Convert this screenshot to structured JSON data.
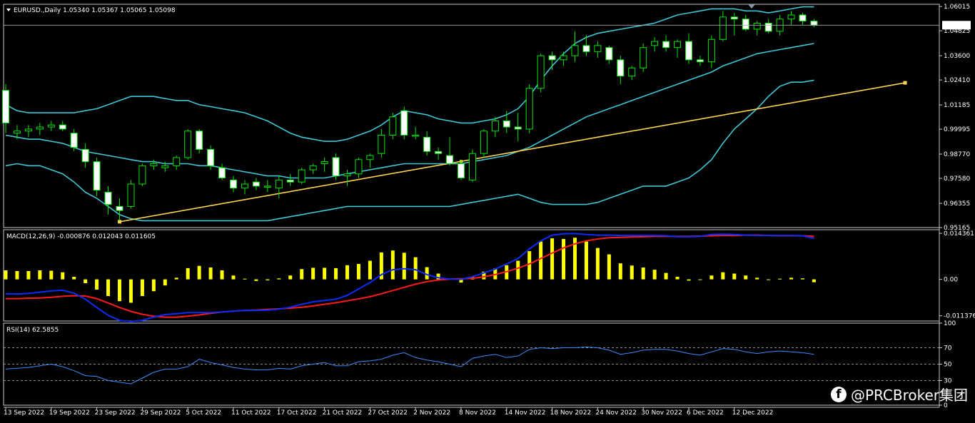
{
  "chart_data": {
    "type": "candlestick",
    "header": "EURUSD.,Daily  1.05340 1.05367 1.05065 1.05098",
    "current_price_label": "1.05098",
    "current_price": 1.05098,
    "price_ylim": [
      0.95165,
      1.06125
    ],
    "price_ticks": [
      "1.06015",
      "1.04825",
      "1.03600",
      "1.02410",
      "1.01185",
      "0.99995",
      "0.98770",
      "0.97580",
      "0.96355",
      "0.95165"
    ],
    "dates": [
      "13 Sep 2022",
      "19 Sep 2022",
      "23 Sep 2022",
      "29 Sep 2022",
      "5 Oct 2022",
      "11 Oct 2022",
      "17 Oct 2022",
      "21 Oct 2022",
      "27 Oct 2022",
      "2 Nov 2022",
      "8 Nov 2022",
      "14 Nov 2022",
      "18 Nov 2022",
      "24 Nov 2022",
      "30 Nov 2022",
      "6 Dec 2022",
      "12 Dec 2022"
    ],
    "candles": [
      [
        1.019,
        1.022,
        0.998,
        1.003
      ],
      [
        0.998,
        1.002,
        0.995,
        0.999
      ],
      [
        0.999,
        1.002,
        0.996,
        1.0
      ],
      [
        1.0,
        1.003,
        0.997,
        1.001
      ],
      [
        1.001,
        1.004,
        0.999,
        1.002
      ],
      [
        1.002,
        1.004,
        0.999,
        1.0
      ],
      [
        0.998,
        1.0,
        0.989,
        0.991
      ],
      [
        0.99,
        0.993,
        0.981,
        0.984
      ],
      [
        0.984,
        0.986,
        0.967,
        0.97
      ],
      [
        0.969,
        0.972,
        0.958,
        0.963
      ],
      [
        0.962,
        0.966,
        0.955,
        0.96
      ],
      [
        0.962,
        0.975,
        0.961,
        0.973
      ],
      [
        0.973,
        0.983,
        0.972,
        0.982
      ],
      [
        0.982,
        0.985,
        0.98,
        0.983
      ],
      [
        0.981,
        0.984,
        0.979,
        0.982
      ],
      [
        0.982,
        0.987,
        0.98,
        0.986
      ],
      [
        0.986,
        1.0,
        0.985,
        0.999
      ],
      [
        0.999,
        1.0,
        0.988,
        0.99
      ],
      [
        0.99,
        0.992,
        0.98,
        0.982
      ],
      [
        0.981,
        0.983,
        0.975,
        0.976
      ],
      [
        0.975,
        0.977,
        0.969,
        0.971
      ],
      [
        0.971,
        0.975,
        0.968,
        0.973
      ],
      [
        0.974,
        0.976,
        0.97,
        0.972
      ],
      [
        0.972,
        0.975,
        0.969,
        0.972
      ],
      [
        0.971,
        0.977,
        0.966,
        0.975
      ],
      [
        0.975,
        0.978,
        0.972,
        0.974
      ],
      [
        0.974,
        0.981,
        0.973,
        0.98
      ],
      [
        0.98,
        0.983,
        0.978,
        0.982
      ],
      [
        0.983,
        0.986,
        0.979,
        0.984
      ],
      [
        0.986,
        0.988,
        0.975,
        0.977
      ],
      [
        0.977,
        0.98,
        0.972,
        0.978
      ],
      [
        0.978,
        0.986,
        0.976,
        0.985
      ],
      [
        0.985,
        0.988,
        0.981,
        0.987
      ],
      [
        0.988,
        1.0,
        0.986,
        0.997
      ],
      [
        0.997,
        1.008,
        0.995,
        1.006
      ],
      [
        1.009,
        1.011,
        0.995,
        0.997
      ],
      [
        0.997,
        1.001,
        0.995,
        0.997
      ],
      [
        0.996,
        0.999,
        0.987,
        0.989
      ],
      [
        0.989,
        0.991,
        0.985,
        0.988
      ],
      [
        0.987,
        0.996,
        0.982,
        0.983
      ],
      [
        0.983,
        0.985,
        0.975,
        0.976
      ],
      [
        0.975,
        0.99,
        0.974,
        0.988
      ],
      [
        0.988,
        1.0,
        0.986,
        0.999
      ],
      [
        0.999,
        1.006,
        0.996,
        1.004
      ],
      [
        1.004,
        1.009,
        0.998,
        1.001
      ],
      [
        1.001,
        1.008,
        0.994,
        1.0
      ],
      [
        1.0,
        1.022,
        0.998,
        1.02
      ],
      [
        1.02,
        1.037,
        1.018,
        1.036
      ],
      [
        1.036,
        1.038,
        1.029,
        1.034
      ],
      [
        1.034,
        1.038,
        1.031,
        1.036
      ],
      [
        1.036,
        1.048,
        1.033,
        1.041
      ],
      [
        1.041,
        1.046,
        1.036,
        1.038
      ],
      [
        1.038,
        1.043,
        1.035,
        1.041
      ],
      [
        1.04,
        1.041,
        1.032,
        1.034
      ],
      [
        1.034,
        1.036,
        1.022,
        1.026
      ],
      [
        1.026,
        1.031,
        1.024,
        1.03
      ],
      [
        1.03,
        1.042,
        1.028,
        1.04
      ],
      [
        1.041,
        1.045,
        1.038,
        1.043
      ],
      [
        1.043,
        1.046,
        1.038,
        1.04
      ],
      [
        1.04,
        1.044,
        1.035,
        1.043
      ],
      [
        1.043,
        1.047,
        1.032,
        1.034
      ],
      [
        1.034,
        1.036,
        1.031,
        1.033
      ],
      [
        1.033,
        1.046,
        1.03,
        1.044
      ],
      [
        1.044,
        1.058,
        1.043,
        1.055
      ],
      [
        1.055,
        1.057,
        1.046,
        1.054
      ],
      [
        1.054,
        1.056,
        1.048,
        1.049
      ],
      [
        1.049,
        1.053,
        1.046,
        1.052
      ],
      [
        1.052,
        1.054,
        1.047,
        1.048
      ],
      [
        1.048,
        1.056,
        1.046,
        1.054
      ],
      [
        1.054,
        1.058,
        1.051,
        1.056
      ],
      [
        1.056,
        1.057,
        1.051,
        1.053
      ],
      [
        1.053,
        1.054,
        1.05,
        1.051
      ]
    ],
    "bollinger": {
      "upper": [
        1.012,
        1.009,
        1.008,
        1.008,
        1.008,
        1.008,
        1.008,
        1.009,
        1.01,
        1.012,
        1.014,
        1.016,
        1.016,
        1.016,
        1.015,
        1.014,
        1.014,
        1.012,
        1.011,
        1.01,
        1.009,
        1.008,
        1.006,
        1.004,
        1.001,
        0.998,
        0.996,
        0.995,
        0.994,
        0.994,
        0.995,
        0.997,
        0.999,
        1.002,
        1.006,
        1.009,
        1.008,
        1.007,
        1.005,
        1.004,
        1.003,
        1.003,
        1.004,
        1.005,
        1.007,
        1.01,
        1.016,
        1.024,
        1.031,
        1.037,
        1.042,
        1.045,
        1.047,
        1.048,
        1.049,
        1.05,
        1.051,
        1.052,
        1.054,
        1.056,
        1.057,
        1.058,
        1.059,
        1.059,
        1.059,
        1.058,
        1.058,
        1.057,
        1.058,
        1.059,
        1.06,
        1.06
      ],
      "middle": [
        0.997,
        0.996,
        0.995,
        0.995,
        0.994,
        0.993,
        0.991,
        0.989,
        0.988,
        0.987,
        0.986,
        0.985,
        0.984,
        0.984,
        0.983,
        0.983,
        0.983,
        0.982,
        0.982,
        0.981,
        0.98,
        0.979,
        0.978,
        0.977,
        0.977,
        0.976,
        0.976,
        0.976,
        0.976,
        0.977,
        0.978,
        0.979,
        0.98,
        0.981,
        0.982,
        0.983,
        0.983,
        0.983,
        0.983,
        0.983,
        0.983,
        0.984,
        0.985,
        0.986,
        0.987,
        0.989,
        0.991,
        0.994,
        0.997,
        1.0,
        1.003,
        1.006,
        1.008,
        1.01,
        1.012,
        1.014,
        1.016,
        1.018,
        1.02,
        1.022,
        1.024,
        1.026,
        1.028,
        1.031,
        1.033,
        1.035,
        1.037,
        1.038,
        1.039,
        1.04,
        1.041,
        1.042
      ],
      "lower": [
        0.982,
        0.983,
        0.982,
        0.982,
        0.98,
        0.978,
        0.974,
        0.969,
        0.966,
        0.962,
        0.958,
        0.956,
        0.955,
        0.955,
        0.955,
        0.955,
        0.955,
        0.955,
        0.955,
        0.955,
        0.955,
        0.955,
        0.955,
        0.955,
        0.956,
        0.957,
        0.958,
        0.959,
        0.96,
        0.961,
        0.962,
        0.962,
        0.962,
        0.962,
        0.962,
        0.962,
        0.962,
        0.962,
        0.962,
        0.962,
        0.963,
        0.964,
        0.965,
        0.966,
        0.967,
        0.968,
        0.966,
        0.964,
        0.963,
        0.963,
        0.963,
        0.963,
        0.964,
        0.966,
        0.968,
        0.97,
        0.972,
        0.972,
        0.972,
        0.974,
        0.976,
        0.98,
        0.985,
        0.993,
        1.0,
        1.005,
        1.01,
        1.016,
        1.021,
        1.023,
        1.023,
        1.024
      ]
    },
    "trendline": {
      "from": [
        10,
        0.9545
      ],
      "to": [
        79,
        1.0227
      ]
    },
    "macd": {
      "label": "MACD(12,26,9) -0.000876 0.012043 0.011605",
      "ylim": [
        -0.013,
        0.0155
      ],
      "ticks": [
        "0.014361",
        "0.00",
        "-0.011376"
      ],
      "histogram": [
        0.0028,
        0.0026,
        0.0026,
        0.0028,
        0.0027,
        0.0022,
        0.0008,
        -0.0012,
        -0.0032,
        -0.0052,
        -0.0068,
        -0.0073,
        -0.0052,
        -0.0037,
        -0.0019,
        0.0005,
        0.0035,
        0.0042,
        0.0037,
        0.0028,
        0.0012,
        0.0002,
        -0.0005,
        -0.0003,
        0.0003,
        0.0012,
        0.0032,
        0.0036,
        0.0036,
        0.0035,
        0.0044,
        0.0048,
        0.0058,
        0.0084,
        0.009,
        0.0083,
        0.0069,
        0.0038,
        0.0018,
        0.0002,
        -0.001,
        0.0007,
        0.0024,
        0.0034,
        0.0044,
        0.0058,
        0.0088,
        0.0118,
        0.0128,
        0.0126,
        0.013,
        0.0118,
        0.0098,
        0.0078,
        0.005,
        0.0043,
        0.0037,
        0.003,
        0.002,
        0.0008,
        -0.0004,
        -0.0002,
        0.0012,
        0.0022,
        0.0018,
        0.0012,
        0.0005,
        0.0,
        0.0002,
        0.0005,
        0.0003,
        -0.0009
      ],
      "signal": [
        -0.006,
        -0.006,
        -0.0059,
        -0.0058,
        -0.0056,
        -0.0053,
        -0.0051,
        -0.0052,
        -0.006,
        -0.0074,
        -0.0088,
        -0.01,
        -0.0109,
        -0.0115,
        -0.0118,
        -0.0118,
        -0.0115,
        -0.0111,
        -0.0106,
        -0.0102,
        -0.0099,
        -0.0097,
        -0.0096,
        -0.0094,
        -0.0092,
        -0.009,
        -0.0087,
        -0.0083,
        -0.0078,
        -0.0073,
        -0.0067,
        -0.0061,
        -0.0054,
        -0.0045,
        -0.0035,
        -0.0025,
        -0.0015,
        -0.0007,
        -0.0002,
        0.0001,
        0.0002,
        0.0003,
        0.0008,
        0.0015,
        0.0024,
        0.0035,
        0.0048,
        0.0065,
        0.0082,
        0.0098,
        0.0111,
        0.012,
        0.0126,
        0.013,
        0.0131,
        0.0132,
        0.0133,
        0.0134,
        0.0134,
        0.0134,
        0.0134,
        0.0135,
        0.0136,
        0.0137,
        0.0137,
        0.0138,
        0.0138,
        0.0137,
        0.0136,
        0.0136,
        0.0136,
        0.0134
      ],
      "macd_line": [
        -0.0045,
        -0.0046,
        -0.0044,
        -0.004,
        -0.0036,
        -0.0034,
        -0.0043,
        -0.0062,
        -0.0088,
        -0.0112,
        -0.0128,
        -0.0132,
        -0.0128,
        -0.0118,
        -0.011,
        -0.0107,
        -0.0104,
        -0.0104,
        -0.0104,
        -0.0102,
        -0.0099,
        -0.0097,
        -0.0097,
        -0.0096,
        -0.0093,
        -0.0087,
        -0.0078,
        -0.007,
        -0.0066,
        -0.0062,
        -0.005,
        -0.003,
        -0.001,
        0.0015,
        0.003,
        0.0033,
        0.003,
        0.0015,
        0.0005,
        0.0001,
        0.0,
        0.0008,
        0.002,
        0.0032,
        0.0048,
        0.0065,
        0.0095,
        0.012,
        0.0138,
        0.0142,
        0.0143,
        0.014,
        0.0138,
        0.0138,
        0.0137,
        0.0137,
        0.0137,
        0.0137,
        0.0136,
        0.0133,
        0.0133,
        0.0134,
        0.014,
        0.0141,
        0.014,
        0.0138,
        0.0137,
        0.0137,
        0.0137,
        0.0137,
        0.0136,
        0.0128
      ]
    },
    "rsi": {
      "label": "RSI(14) 62.5855",
      "ylim": [
        0,
        100
      ],
      "ticks": [
        "100",
        "70",
        "50",
        "30",
        "0"
      ],
      "levels": [
        70,
        50,
        30
      ],
      "values": [
        44,
        45,
        46,
        48,
        50,
        47,
        42,
        36,
        35,
        30,
        28,
        26,
        33,
        40,
        44,
        44,
        47,
        56,
        52,
        49,
        46,
        44,
        43,
        43,
        45,
        44,
        48,
        50,
        52,
        48,
        48,
        53,
        54,
        56,
        61,
        64,
        58,
        55,
        53,
        50,
        47,
        57,
        60,
        62,
        58,
        60,
        68,
        70,
        69,
        70,
        70,
        71,
        70,
        67,
        62,
        64,
        67,
        68,
        68,
        66,
        63,
        61,
        65,
        69,
        68,
        65,
        63,
        65,
        66,
        65,
        64,
        62
      ]
    },
    "colors": {
      "bollinger": "#3fc6d6",
      "trendline": "#ffd44a",
      "histogram": "#ffff00",
      "macd_line": "#0a2cff",
      "signal_line": "#ff1a1a",
      "rsi": "#3b8cff",
      "grid": "#c8c8c8"
    }
  },
  "watermark": {
    "icon": "facebook-icon",
    "text": "@PRCBroker集团"
  }
}
